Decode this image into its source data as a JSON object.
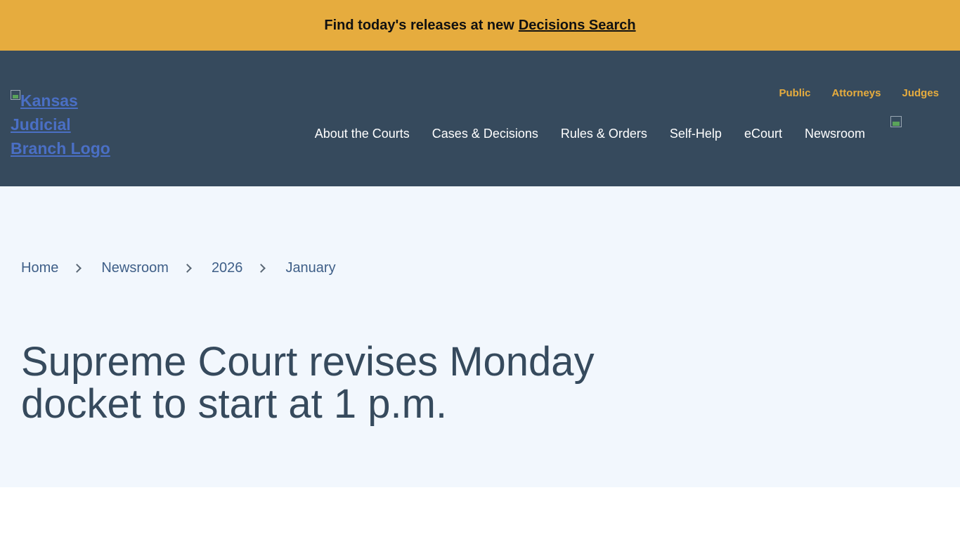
{
  "banner": {
    "text": "Find today's releases at new",
    "link": "Decisions Search"
  },
  "header": {
    "logo_alt": "Kansas Judicial Branch Logo",
    "audience_links": [
      "Public",
      "Attorneys",
      "Judges"
    ],
    "nav": [
      "About the Courts",
      "Cases & Decisions",
      "Rules & Orders",
      "Self-Help",
      "eCourt",
      "Newsroom"
    ]
  },
  "breadcrumb": [
    "Home",
    "Newsroom",
    "2026",
    "January"
  ],
  "page": {
    "title": "Supreme Court revises Monday docket to start at 1 p.m."
  },
  "colors": {
    "banner": "#e6ac3e",
    "header": "#364a5d",
    "hero": "#f2f7fd"
  }
}
